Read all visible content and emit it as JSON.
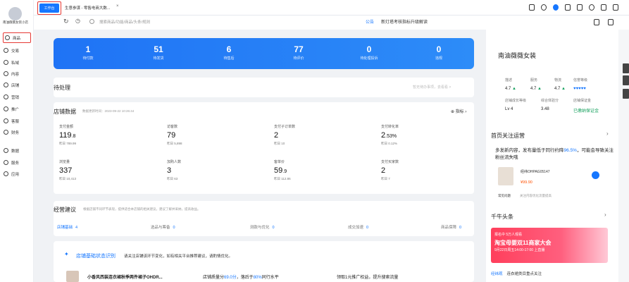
{
  "sidebar": {
    "shop_name": "南油薇薇女装小店",
    "items": [
      {
        "label": "商品",
        "active": true
      },
      {
        "label": "交易"
      },
      {
        "label": "私域"
      },
      {
        "label": "内容"
      },
      {
        "label": "店铺"
      },
      {
        "label": "营销"
      },
      {
        "label": "推广"
      },
      {
        "label": "客服"
      },
      {
        "label": "财务"
      },
      {
        "label": "数据"
      },
      {
        "label": "服务"
      },
      {
        "label": "应用"
      }
    ]
  },
  "tabs": {
    "active": "工作台",
    "second": "生意参谋 - 零售电商大数..."
  },
  "toolbar": {
    "search_placeholder": "搜索商品/功能/商品/头条/规则",
    "notice_tag": "公告",
    "notice_text": "新灯塔考核指标升级解读"
  },
  "banner": [
    {
      "value": "1",
      "label": "待付款"
    },
    {
      "value": "51",
      "label": "待发货"
    },
    {
      "value": "6",
      "label": "待售后"
    },
    {
      "value": "77",
      "label": "待评价"
    },
    {
      "value": "0",
      "label": "待处理投诉"
    },
    {
      "value": "0",
      "label": "违规"
    }
  ],
  "todo": {
    "title": "待处理",
    "hint": "暂无待办事项，去看看 >"
  },
  "shop_data": {
    "title": "店铺数据",
    "updated": "数据更新时间：2023-09-22 10:26:44",
    "metric_btn": "指标",
    "metrics": [
      {
        "label": "支付金额",
        "int": "119",
        "dec": ".8",
        "yesterday": "昨日 789.99"
      },
      {
        "label": "访客数",
        "int": "79",
        "dec": "",
        "yesterday": "昨日 5,898"
      },
      {
        "label": "支付子订单数",
        "int": "2",
        "dec": "",
        "yesterday": "昨日 10"
      },
      {
        "label": "支付转化率",
        "int": "2",
        "dec": ".53%",
        "yesterday": "昨日 0.12%"
      },
      {
        "label": "浏览量",
        "int": "337",
        "dec": "",
        "yesterday": "昨日 10,413"
      },
      {
        "label": "加购人数",
        "int": "3",
        "dec": "",
        "yesterday": "昨日 63"
      },
      {
        "label": "客单价",
        "int": "59",
        "dec": ".9",
        "yesterday": "昨日 112.86"
      },
      {
        "label": "支付买家数",
        "int": "2",
        "dec": "",
        "yesterday": "昨日 7"
      }
    ]
  },
  "advice": {
    "title": "经营建议",
    "hint": "根据店铺不同环节表现，提供适合本店铺的相关建议，建议了解并采纳，提高收益。",
    "steps": [
      {
        "label": "店铺基础",
        "count": "4"
      },
      {
        "label": "选品与筹备",
        "count": "0"
      },
      {
        "label": "测款与优化",
        "count": "0"
      },
      {
        "label": "成交加速",
        "count": "0"
      },
      {
        "label": "商品保障",
        "count": "0"
      }
    ]
  },
  "basic": {
    "title": "店铺基础状态识别",
    "subtitle": "请关注店铺该环节变化，如有相关平台推荐建议，请酌情优化。",
    "product": "小香风西装连衣裙秋季两件裙子OHDR...",
    "rank_prefix": "店铺质量分",
    "rank_score": "69.0分",
    "rank_mid": "，落后于",
    "rank_pct": "80%",
    "rank_suffix": "同行水平",
    "promo": "领取1元推广权益，提升搜索流量"
  },
  "right_panel": {
    "shop_name": "南油薇薇女装",
    "scores": [
      {
        "label": "描述",
        "value": "4.7",
        "trend": "▲"
      },
      {
        "label": "服务",
        "value": "4.7",
        "trend": "▲"
      },
      {
        "label": "物流",
        "value": "4.7",
        "trend": "▲"
      },
      {
        "label": "信誉等级",
        "value": "♥♥♥♥♥",
        "trend": ""
      },
      {
        "label": "店铺成长等级",
        "value": "Lv 4",
        "trend": ""
      },
      {
        "label": "综合体验分",
        "value": "3.48",
        "trend": ""
      },
      {
        "label": "店铺保证金",
        "value": "已缴纳保证金",
        "trend": ""
      }
    ],
    "follow_title": "首页关注运营",
    "follow_desc_1": "多发新内容，发布量低于同行约降",
    "follow_pct": "96.5%",
    "follow_desc_2": "，可能会导致关注粉丝流失哦",
    "follow_product": "经纬OHPAG05147",
    "follow_price": "¥99.90",
    "faq": "常见问题",
    "faq_link": "关注内容优化流量提高",
    "news_title": "千牛头条",
    "news_banner_tag": "报名中  5万人观看",
    "news_banner_title": "淘宝母婴双11商家大会",
    "news_banner_time": "9月22日周五14:00-17:00 上直播",
    "news_tag": "经纬观",
    "news_text": "连衣裙类目重点关注"
  },
  "colors": {
    "accent": "#1677ff",
    "highlight": "#e53935",
    "up": "#1aa260"
  }
}
